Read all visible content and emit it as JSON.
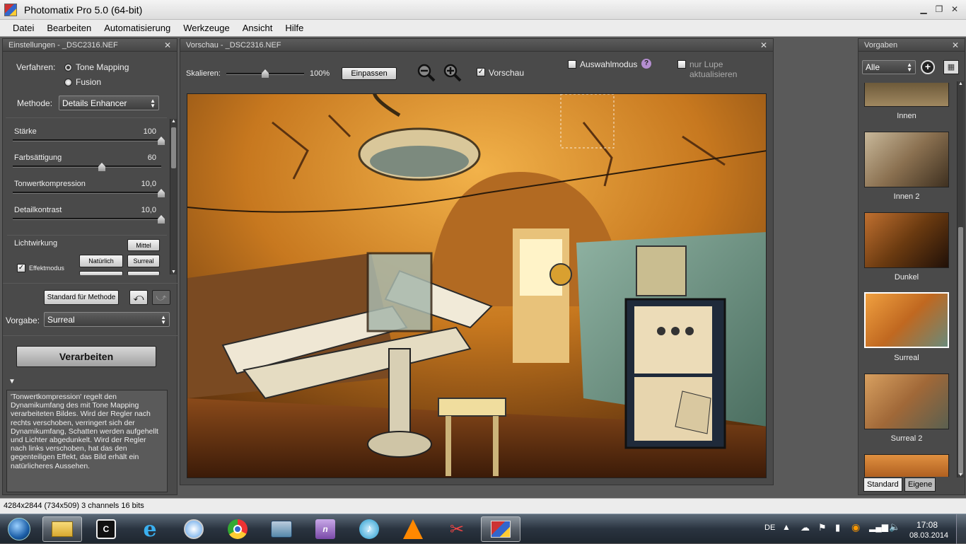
{
  "window": {
    "title": "Photomatix Pro 5.0 (64-bit)"
  },
  "menu": [
    "Datei",
    "Bearbeiten",
    "Automatisierung",
    "Werkzeuge",
    "Ansicht",
    "Hilfe"
  ],
  "settings": {
    "header": "Einstellungen - _DSC2316.NEF",
    "verfahren_label": "Verfahren:",
    "option_tone_mapping": "Tone Mapping",
    "option_fusion": "Fusion",
    "methode_label": "Methode:",
    "methode_value": "Details Enhancer",
    "sliders": [
      {
        "label": "Stärke",
        "value": "100",
        "fraction": 1.0
      },
      {
        "label": "Farbsättigung",
        "value": "60",
        "fraction": 0.6
      },
      {
        "label": "Tonwertkompression",
        "value": "10,0",
        "fraction": 1.0
      },
      {
        "label": "Detailkontrast",
        "value": "10,0",
        "fraction": 1.0
      }
    ],
    "lichtwirkung_label": "Lichtwirkung",
    "btn_mittel": "Mittel",
    "btn_natuerlich": "Natürlich",
    "btn_surreal": "Surreal",
    "effektmodus_label": "Effektmodus",
    "standard_button": "Standard für Methode",
    "vorgabe_label": "Vorgabe:",
    "vorgabe_value": "Surreal",
    "process_button": "Verarbeiten",
    "help_text": "'Tonwertkompression' regelt den Dynamikumfang des mit Tone Mapping verarbeiteten Bildes. Wird der Regler nach rechts verschoben, verringert sich der Dynamikumfang, Schatten werden aufgehellt und Lichter abgedunkelt. Wird der Regler nach links verschoben, hat das den gegenteiligen Effekt, das Bild erhält ein natürlicheres Aussehen."
  },
  "preview": {
    "header": "Vorschau - _DSC2316.NEF",
    "scale_label": "Skalieren:",
    "scale_value": "100%",
    "fit_button": "Einpassen",
    "preview_label": "Vorschau",
    "selection_label": "Auswahlmodus",
    "help_icon_text": "?",
    "loupe_label": "nur Lupe aktualisieren"
  },
  "presets": {
    "header": "Vorgaben",
    "filter_value": "Alle",
    "items": [
      {
        "label": "Innen"
      },
      {
        "label": "Innen 2"
      },
      {
        "label": "Dunkel"
      },
      {
        "label": "Surreal"
      },
      {
        "label": "Surreal 2"
      }
    ],
    "tab_standard": "Standard",
    "tab_eigene": "Eigene"
  },
  "status": {
    "text": "4284x2844 (734x509) 3 channels 16 bits"
  },
  "taskbar": {
    "lang": "DE",
    "time": "17:08",
    "date": "08.03.2014"
  }
}
